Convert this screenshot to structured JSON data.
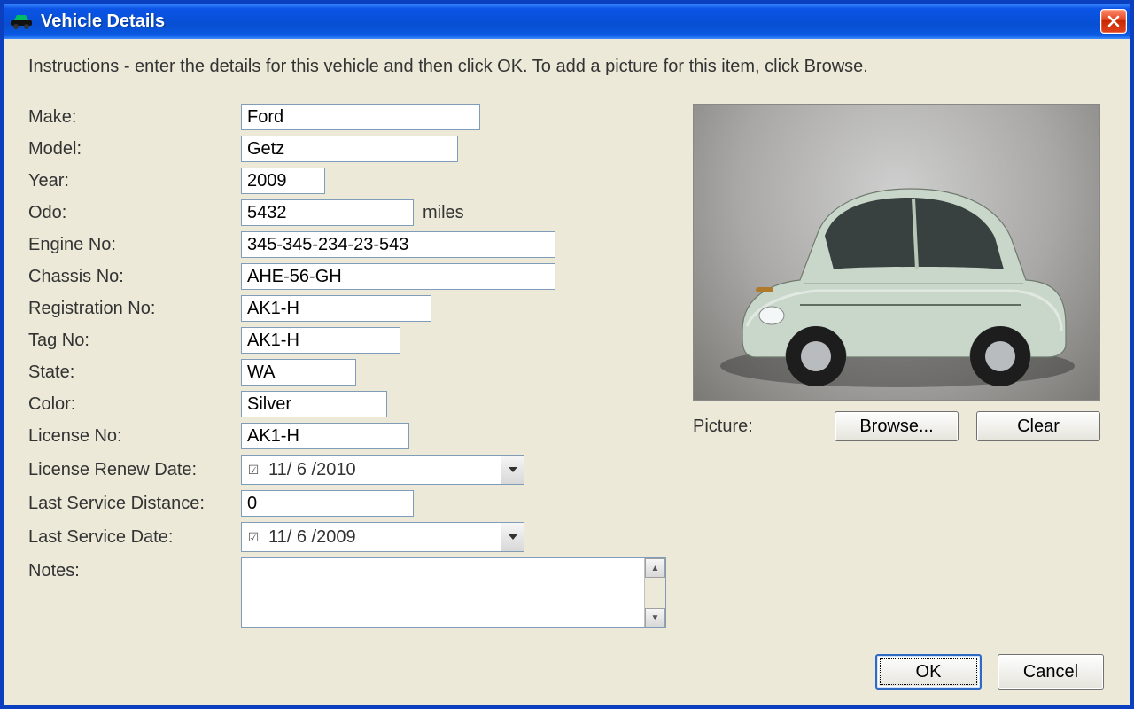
{
  "window": {
    "title": "Vehicle Details"
  },
  "instructions": "Instructions - enter the details for this vehicle and then click OK. To add a picture for this item, click Browse.",
  "labels": {
    "make": "Make:",
    "model": "Model:",
    "year": "Year:",
    "odo": "Odo:",
    "odo_unit": "miles",
    "engine_no": "Engine No:",
    "chassis_no": "Chassis No:",
    "registration_no": "Registration No:",
    "tag_no": "Tag No:",
    "state": "State:",
    "color": "Color:",
    "license_no": "License No:",
    "license_renew_date": "License Renew Date:",
    "last_service_distance": "Last Service Distance:",
    "last_service_date": "Last Service Date:",
    "notes": "Notes:",
    "picture": "Picture:"
  },
  "values": {
    "make": "Ford",
    "model": "Getz",
    "year": "2009",
    "odo": "5432",
    "engine_no": "345-345-234-23-543",
    "chassis_no": "AHE-56-GH",
    "registration_no": "AK1-H",
    "tag_no": "AK1-H",
    "state": "WA",
    "color": "Silver",
    "license_no": "AK1-H",
    "license_renew_date": "11/ 6 /2010",
    "last_service_distance": "0",
    "last_service_date": "11/ 6 /2009",
    "notes": ""
  },
  "buttons": {
    "browse": "Browse...",
    "clear": "Clear",
    "ok": "OK",
    "cancel": "Cancel"
  }
}
